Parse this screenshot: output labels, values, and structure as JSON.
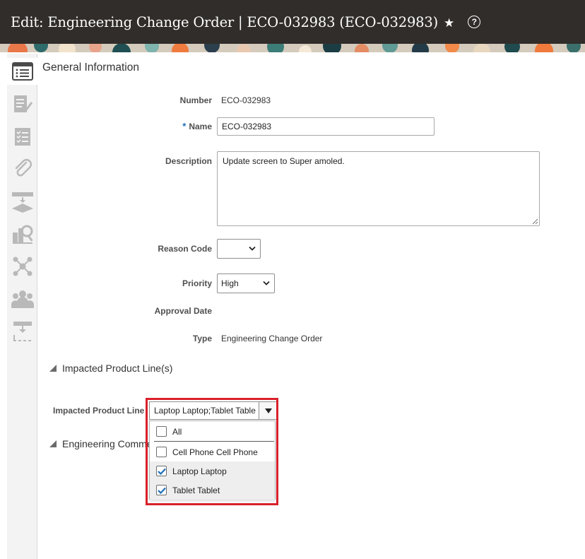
{
  "header": {
    "title": "Edit: Engineering Change Order | ECO-032983 (ECO-032983)",
    "star_icon": "★",
    "help_icon": "?"
  },
  "rail": {
    "items": [
      {
        "icon": "general-information-icon"
      },
      {
        "icon": "edit-document-icon"
      },
      {
        "icon": "checklist-icon"
      },
      {
        "icon": "attachment-icon"
      },
      {
        "icon": "workflow-icon"
      },
      {
        "icon": "search-analysis-icon"
      },
      {
        "icon": "network-icon"
      },
      {
        "icon": "people-icon"
      },
      {
        "icon": "hierarchy-icon"
      }
    ]
  },
  "section": {
    "title": "General Information"
  },
  "form": {
    "number_label": "Number",
    "number_value": "ECO-032983",
    "required_marker": "*",
    "name_label": "Name",
    "name_value": "ECO-032983",
    "description_label": "Description",
    "description_value": "Update  screen to Super amoled.",
    "reason_code_label": "Reason Code",
    "reason_code_value": "",
    "priority_label": "Priority",
    "priority_value": "High",
    "approval_date_label": "Approval Date",
    "type_label": "Type",
    "type_value": "Engineering Change Order"
  },
  "impacted": {
    "section_title": "Impacted Product Line(s)",
    "field_label": "Impacted Product Line",
    "field_value": "Laptop Laptop;Tablet Table",
    "options": [
      {
        "label": "All",
        "checked": false
      },
      {
        "label": "Cell Phone Cell Phone",
        "checked": false
      },
      {
        "label": "Laptop Laptop",
        "checked": true
      },
      {
        "label": "Tablet Tablet",
        "checked": true
      }
    ]
  },
  "comments": {
    "section_title": "Engineering Comme"
  },
  "colors": {
    "header_bg": "#312d2a",
    "required": "#1d6fb8",
    "check": "#1d6fb8",
    "highlight": "#d9202a"
  }
}
